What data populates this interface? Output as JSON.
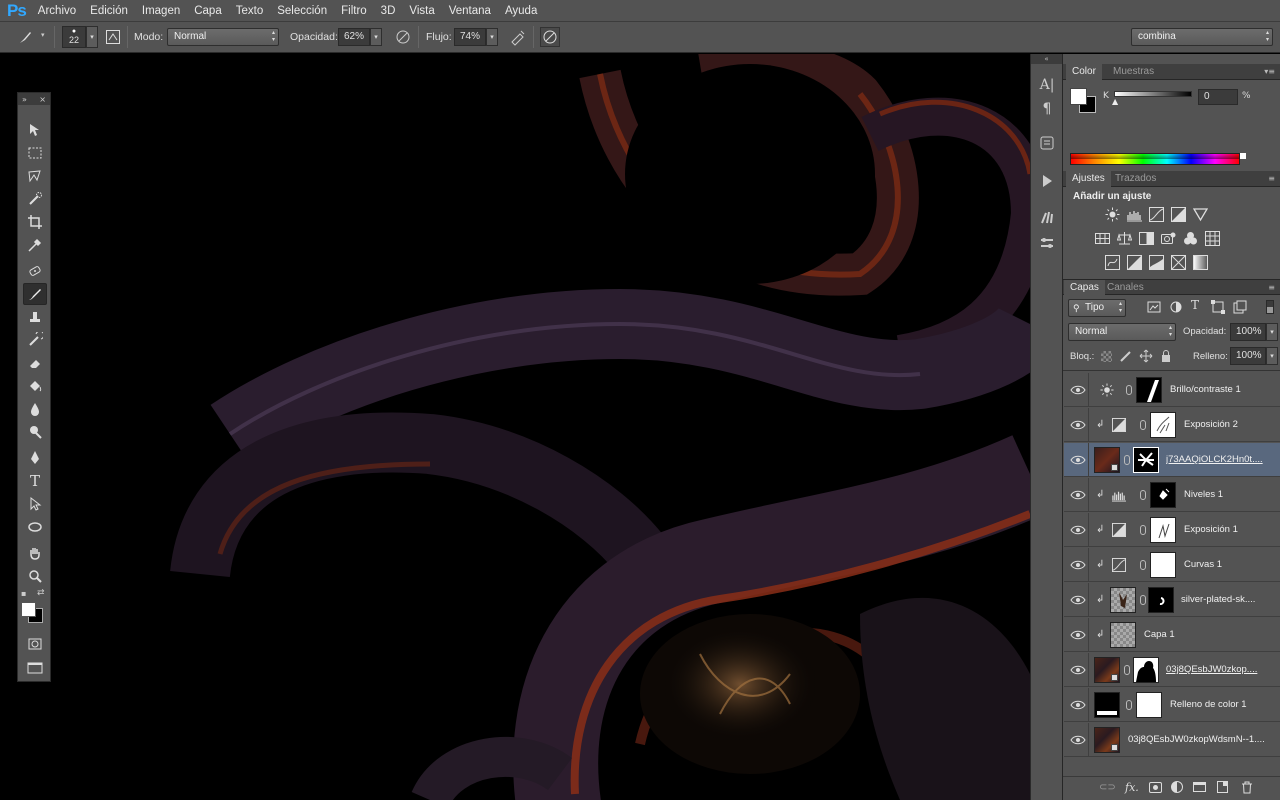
{
  "app": {
    "logo": "Ps"
  },
  "menu": [
    "Archivo",
    "Edición",
    "Imagen",
    "Capa",
    "Texto",
    "Selección",
    "Filtro",
    "3D",
    "Vista",
    "Ventana",
    "Ayuda"
  ],
  "options": {
    "brush_size": "22",
    "mode_label": "Modo:",
    "mode_value": "Normal",
    "opacity_label": "Opacidad:",
    "opacity_value": "62%",
    "flow_label": "Flujo:",
    "flow_value": "74%",
    "workspace": "combina"
  },
  "color_panel": {
    "tabs": [
      "Color",
      "Muestras"
    ],
    "channel_label": "K",
    "channel_value": "0",
    "channel_unit": "%",
    "foreground": "#ffffff",
    "background": "#000000"
  },
  "adjustments_panel": {
    "tabs": [
      "Ajustes",
      "Trazados"
    ],
    "title": "Añadir un ajuste"
  },
  "layers_panel": {
    "tabs": [
      "Capas",
      "Canales"
    ],
    "filter_kind": "Tipo",
    "blend_mode": "Normal",
    "opacity_label": "Opacidad:",
    "opacity_value": "100%",
    "lock_label": "Bloq.:",
    "fill_label": "Relleno:",
    "fill_value": "100%",
    "layers": [
      {
        "name": "Brillo/contraste 1",
        "icon": "brightness-icon",
        "clipped": false,
        "selected": false
      },
      {
        "name": "Exposición 2",
        "icon": "exposure-icon",
        "clipped": true,
        "selected": false
      },
      {
        "name": "j73AAQiOLCK2Hn0t....",
        "icon": "smart-object",
        "clipped": false,
        "selected": true
      },
      {
        "name": "Niveles 1",
        "icon": "levels-icon",
        "clipped": true,
        "selected": false
      },
      {
        "name": "Exposición 1",
        "icon": "exposure-icon",
        "clipped": true,
        "selected": false
      },
      {
        "name": "Curvas 1",
        "icon": "curves-icon",
        "clipped": true,
        "selected": false
      },
      {
        "name": "silver-plated-sk....",
        "icon": "image",
        "clipped": true,
        "selected": false
      },
      {
        "name": "Capa 1",
        "icon": "transparent",
        "clipped": true,
        "selected": false
      },
      {
        "name": "03j8QEsbJW0zkop....",
        "icon": "image",
        "clipped": false,
        "selected": false
      },
      {
        "name": "Relleno de color 1",
        "icon": "fill",
        "clipped": false,
        "selected": false
      },
      {
        "name": "03j8QEsbJW0zkopWdsmN--1....",
        "icon": "image",
        "clipped": false,
        "selected": false
      }
    ]
  },
  "colors": {
    "ui_bg": "#535353",
    "panel_dark": "#3f3f3f",
    "selection": "#59687e",
    "ps_blue": "#31a8ff"
  }
}
